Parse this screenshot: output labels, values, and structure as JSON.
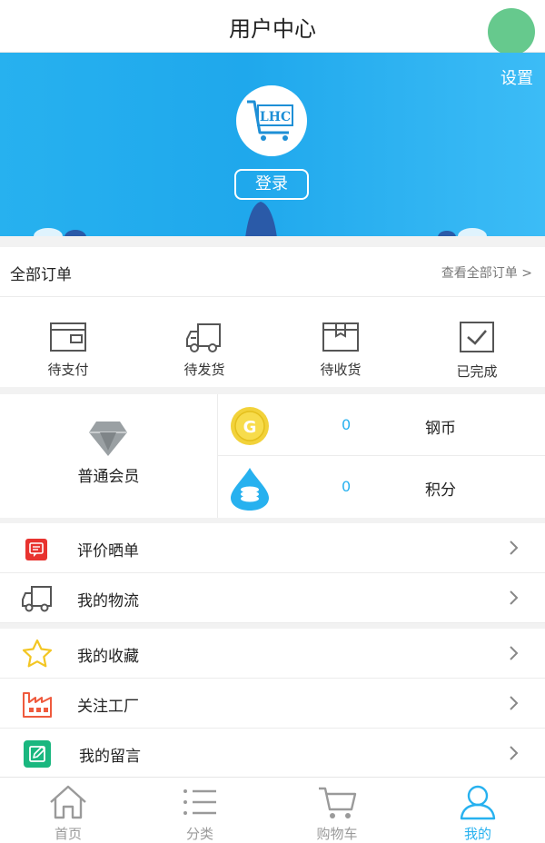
{
  "header": {
    "title": "用户中心"
  },
  "banner": {
    "settings_label": "设置",
    "logo_text": "LHC",
    "login_label": "登录"
  },
  "orders": {
    "title": "全部订单",
    "view_all": "查看全部订单 >",
    "items": [
      {
        "label": "待支付",
        "icon": "wallet-icon"
      },
      {
        "label": "待发货",
        "icon": "truck-icon"
      },
      {
        "label": "待收货",
        "icon": "package-icon"
      },
      {
        "label": "已完成",
        "icon": "checkbox-icon"
      }
    ]
  },
  "member": {
    "level": "普通会员",
    "coins": {
      "value": "0",
      "label": "钢币",
      "badge": "G"
    },
    "points": {
      "value": "0",
      "label": "积分"
    }
  },
  "menu": [
    {
      "label": "评价晒单",
      "icon": "comment-icon",
      "color": "#e8332f"
    },
    {
      "label": "我的物流",
      "icon": "truck-icon",
      "color": "#555555"
    },
    {
      "label": "我的收藏",
      "icon": "star-icon",
      "color": "#f3c623"
    },
    {
      "label": "关注工厂",
      "icon": "factory-icon",
      "color": "#ef5a3d"
    },
    {
      "label": "我的留言",
      "icon": "edit-icon",
      "color": "#1ab77f"
    }
  ],
  "tabbar": [
    {
      "label": "首页",
      "icon": "home-icon"
    },
    {
      "label": "分类",
      "icon": "list-icon"
    },
    {
      "label": "购物车",
      "icon": "cart-icon"
    },
    {
      "label": "我的",
      "icon": "user-icon",
      "active": true
    }
  ],
  "colors": {
    "accent": "#27b1ef",
    "green": "#66c98d"
  }
}
